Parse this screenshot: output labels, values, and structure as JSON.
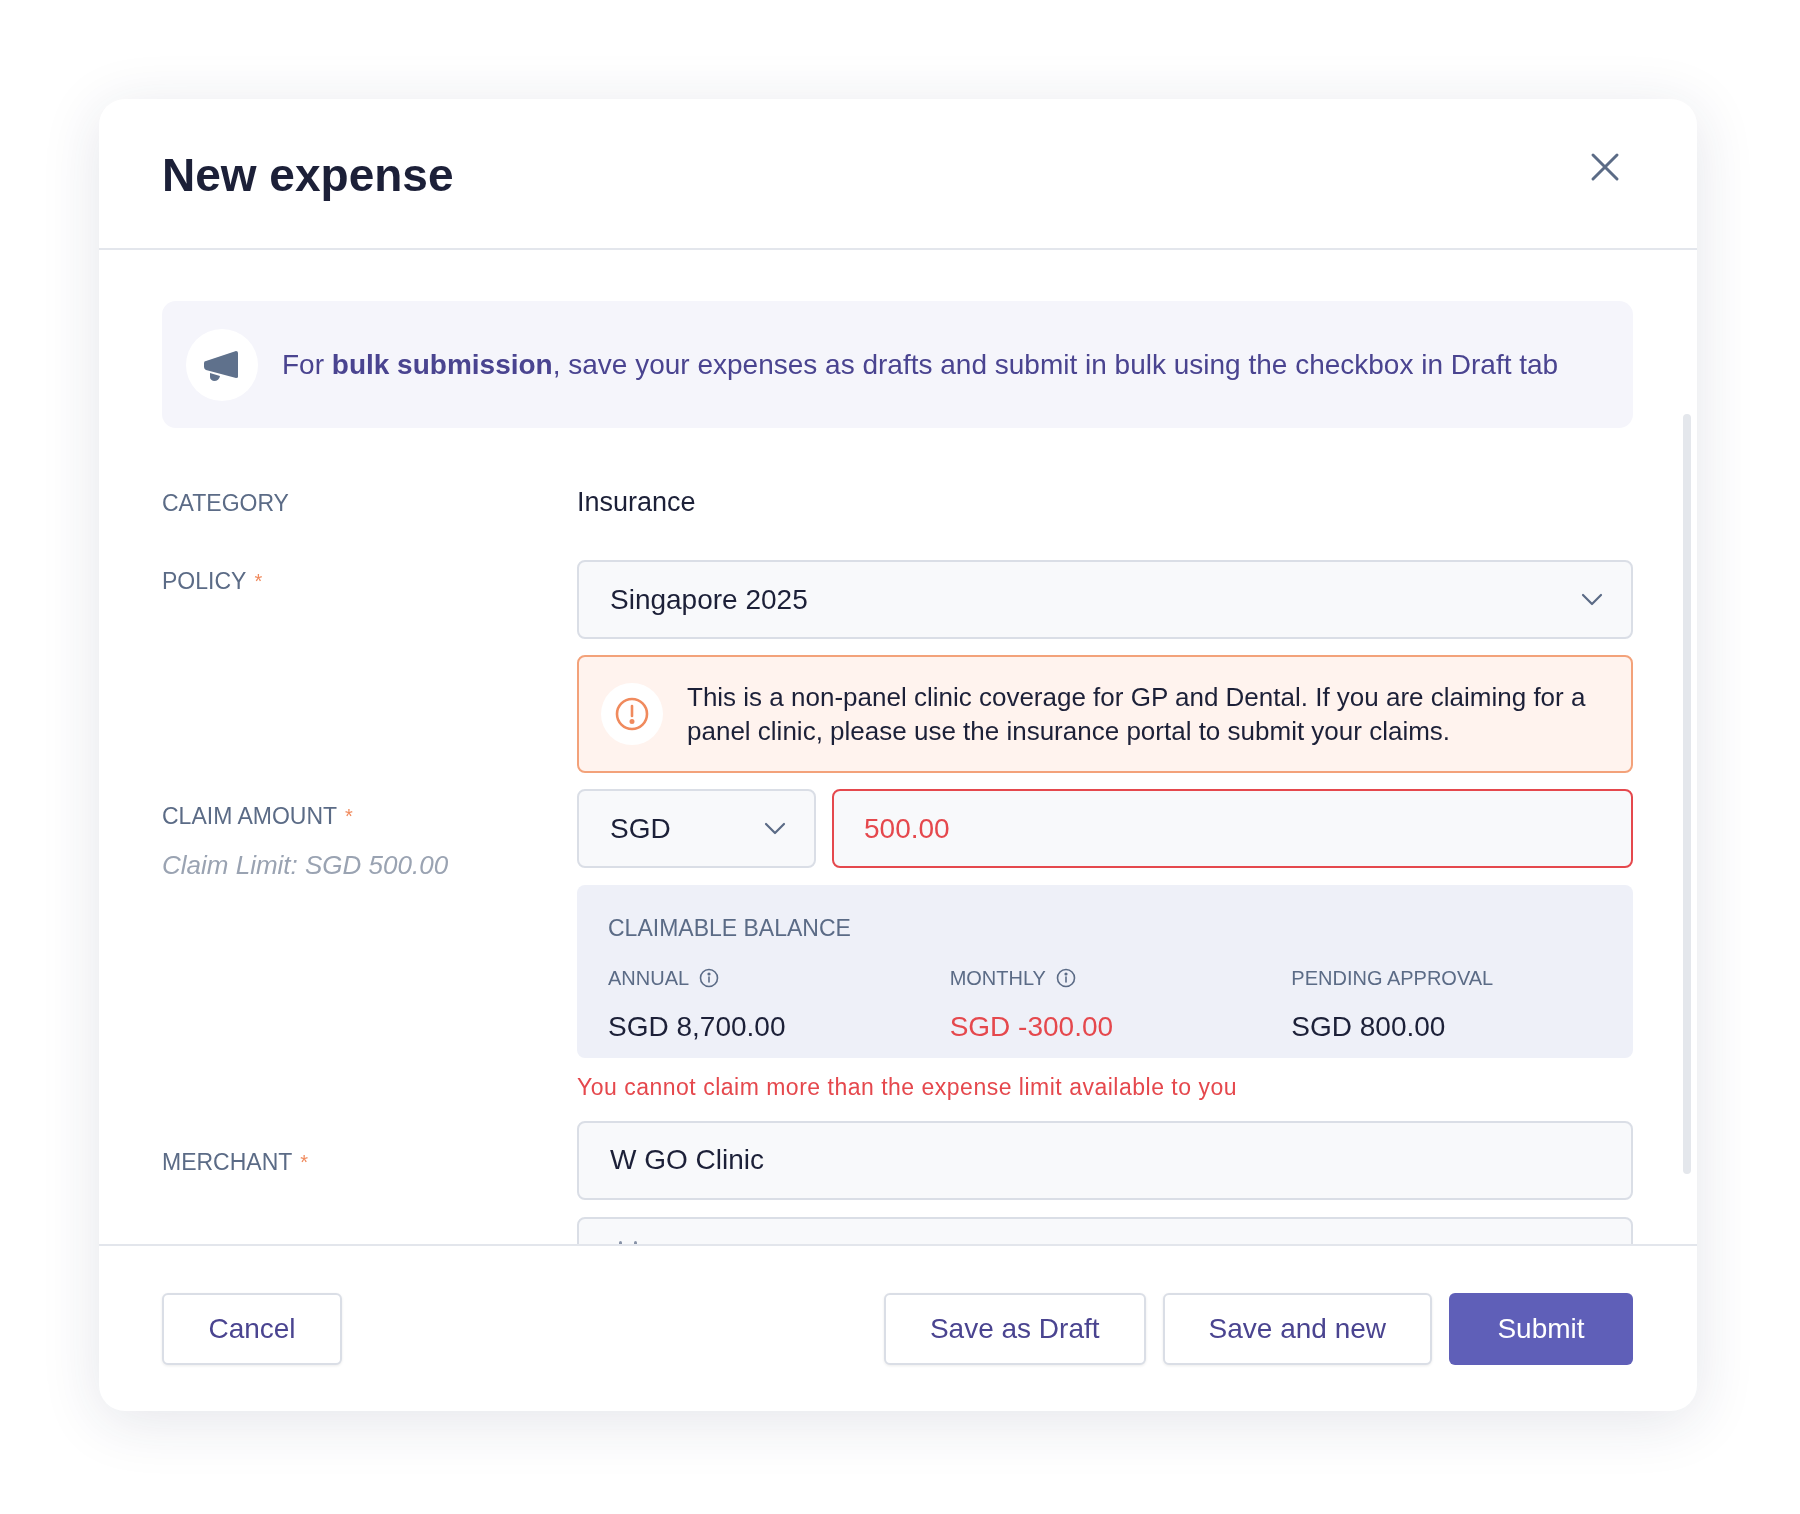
{
  "dialog": {
    "title": "New expense"
  },
  "banner": {
    "text": "For **bulk submission**, save your expenses as drafts and submit in bulk using the checkbox in Draft tab"
  },
  "category": {
    "label": "CATEGORY",
    "value": "Insurance"
  },
  "policy": {
    "label": "POLICY",
    "required_mark": "*",
    "value": "Singapore 2025"
  },
  "warning": {
    "text": "This is a non-panel clinic coverage for GP and Dental. If you are claiming for a panel clinic, please use the insurance portal to submit your claims."
  },
  "claim_amount": {
    "label": "CLAIM AMOUNT",
    "required_mark": "*",
    "hint": "Claim Limit: SGD 500.00",
    "currency": "SGD",
    "value": "500.00",
    "invalid": true
  },
  "claimable_balance": {
    "title": "CLAIMABLE BALANCE",
    "items": [
      {
        "label": "ANNUAL",
        "info": true,
        "value": "SGD 8,700.00",
        "negative": false
      },
      {
        "label": "MONTHLY",
        "info": true,
        "value": "SGD -300.00",
        "negative": true
      },
      {
        "label": "PENDING APPROVAL",
        "info": false,
        "value": "SGD 800.00",
        "negative": false
      }
    ]
  },
  "error": "You cannot claim more than the expense limit available to you",
  "merchant": {
    "label": "MERCHANT",
    "required_mark": "*",
    "value": "W GO Clinic"
  },
  "footer": {
    "cancel": "Cancel",
    "buttons": [
      {
        "label": "Save as Draft",
        "kind": "secondary"
      },
      {
        "label": "Save and new",
        "kind": "secondary"
      },
      {
        "label": "Submit",
        "kind": "primary"
      }
    ]
  }
}
